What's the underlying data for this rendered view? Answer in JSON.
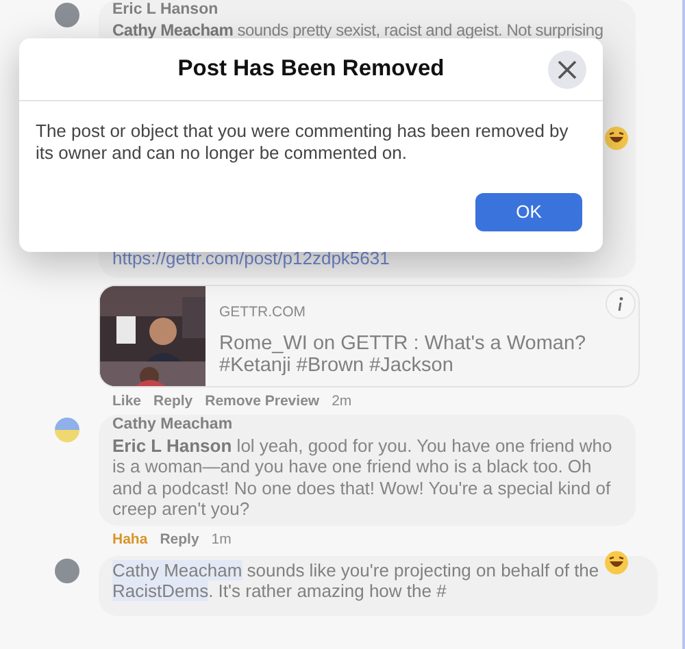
{
  "comments": [
    {
      "author": "Eric L Hanson",
      "body": "**Cathy Meacham** sounds pretty sexist, racist and ageist. Not surprising",
      "link": "https://gettr.com/post/p12zdpk5631",
      "preview": {
        "kind": "picture",
        "domain": "GETTR.COM",
        "title": "Rome_WI on GETTR : What's a Woman? #Ketanji #Brown #Jackson"
      },
      "actions": [
        {
          "label": "Like",
          "selected": false
        },
        {
          "label": "Reply",
          "selected": false
        },
        {
          "label": "Remove Preview",
          "selected": false
        }
      ],
      "time": "2m",
      "reaction": true
    },
    {
      "author": "Cathy Meacham",
      "body": "**Eric L Hanson** lol yeah, good for you. You have one friend who is a woman—and you have one friend who is a black too. Oh and a podcast! No one does that! Wow! You're a special kind of creep aren't you?",
      "actions": [
        {
          "label": "Haha",
          "selected": true
        },
        {
          "label": "Reply",
          "selected": false
        }
      ],
      "time": "1m",
      "reaction": true
    }
  ],
  "reply_field": {
    "segments": [
      {
        "kind": "mention",
        "text": "Cathy Meacham"
      },
      {
        "kind": "text",
        "text": " sounds like you're projecting on behalf of the "
      },
      {
        "kind": "mention",
        "text": "RacistDems"
      },
      {
        "kind": "text",
        "text": ".  It's rather amazing how the #"
      }
    ]
  },
  "dialog": {
    "title": "Post Has Been Removed",
    "message": "The post or object that you were commenting has been removed by its owner and can no longer be commented on.",
    "buttons": [
      "OK"
    ]
  }
}
